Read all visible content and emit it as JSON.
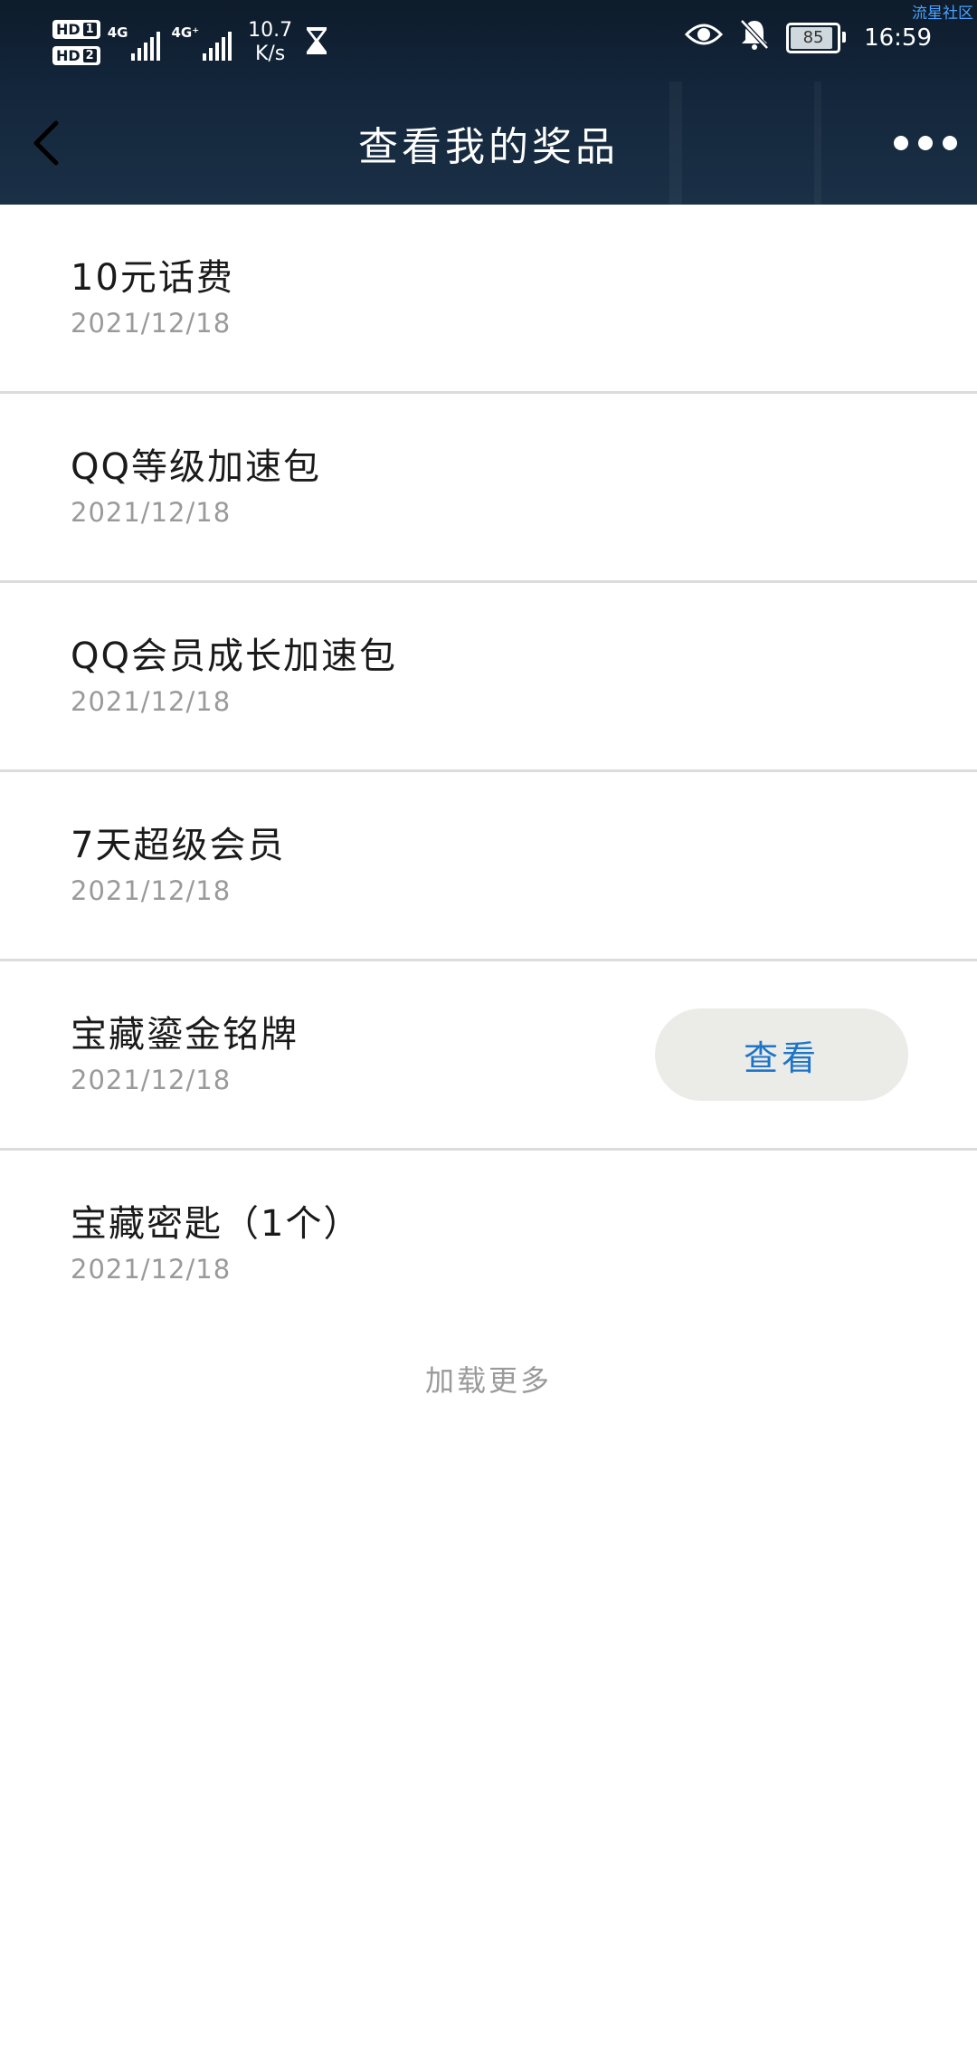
{
  "status_bar": {
    "watermark": "流星社区",
    "sim1": "HD",
    "sim1_num": "1",
    "sim2": "HD",
    "sim2_num": "2",
    "net1": "4G",
    "net2": "4G⁺",
    "speed_value": "10.7",
    "speed_unit": "K/s",
    "battery": "85",
    "time": "16:59",
    "icons": [
      "hourglass-icon",
      "eye-icon",
      "bell-muted-icon",
      "battery-icon"
    ]
  },
  "header": {
    "title": "查看我的奖品",
    "back_icon": "chevron-left-icon",
    "more_icon": "more-dots-icon"
  },
  "prizes": [
    {
      "name": "10元话费",
      "date": "2021/12/18"
    },
    {
      "name": "QQ等级加速包",
      "date": "2021/12/18"
    },
    {
      "name": "QQ会员成长加速包",
      "date": "2021/12/18"
    },
    {
      "name": "7天超级会员",
      "date": "2021/12/18"
    },
    {
      "name": "宝藏鎏金铭牌",
      "date": "2021/12/18",
      "action": "查看"
    },
    {
      "name": "宝藏密匙（1个）",
      "date": "2021/12/18"
    }
  ],
  "load_more": "加载更多",
  "colors": {
    "header_bg": "#13253a",
    "accent": "#1d74c8",
    "button_bg": "#ebebe7",
    "date_text": "#9a9a9a",
    "divider": "#dcdcdc"
  }
}
